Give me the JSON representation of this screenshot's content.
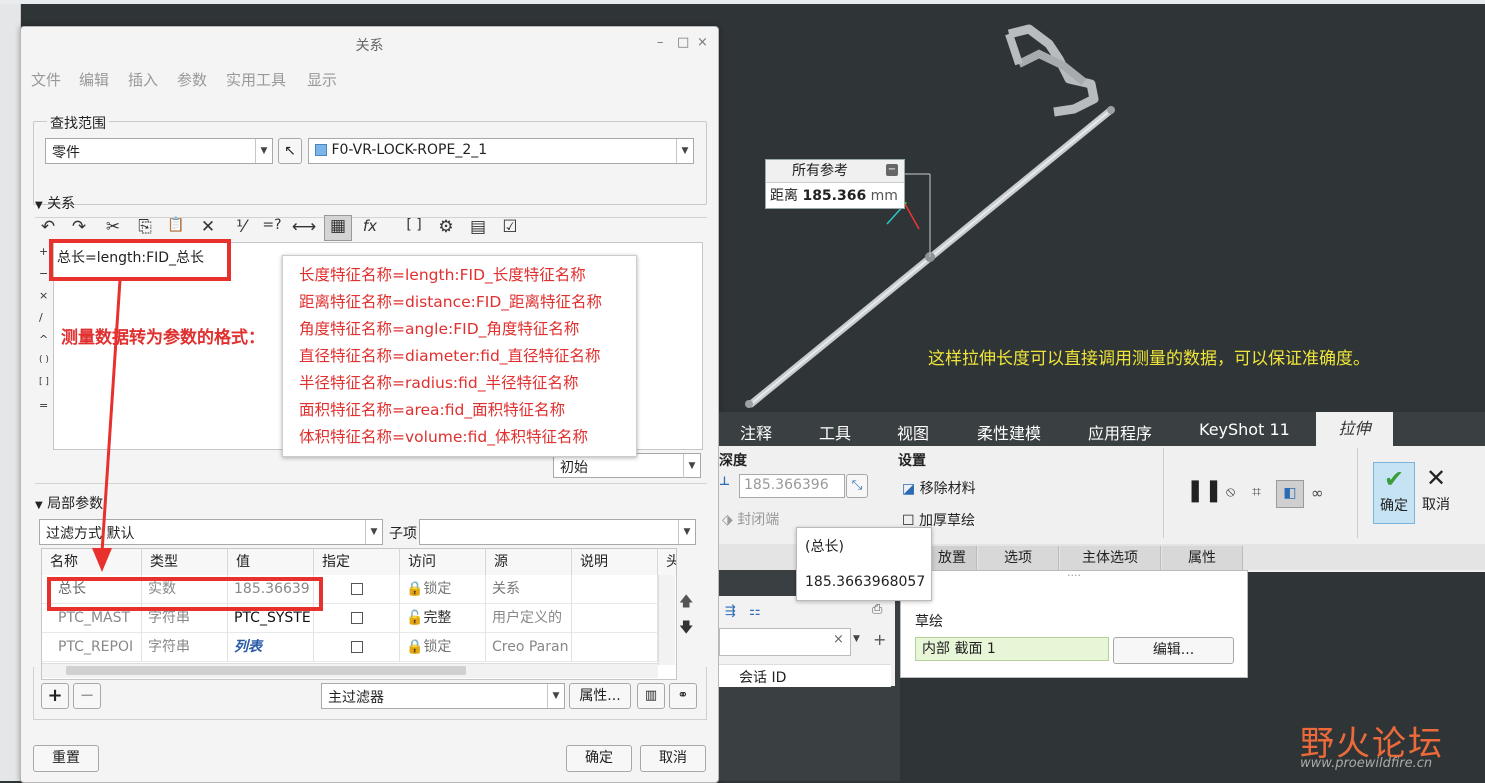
{
  "dialog": {
    "title": "关系",
    "window_controls": [
      "–",
      "□",
      "×"
    ],
    "menu": [
      "文件",
      "编辑",
      "插入",
      "参数",
      "实用工具",
      "显示"
    ],
    "scope": {
      "legend": "查找范围",
      "type_value": "零件",
      "model_value": "F0-VR-LOCK-ROPE_2_1"
    },
    "relations": {
      "header": "关系",
      "toolbar_icons": [
        "undo-icon",
        "redo-icon",
        "cut-icon",
        "copy-icon",
        "paste-icon",
        "delete-icon",
        "units-icon",
        "evaluate-icon",
        "insert-dimension-icon",
        "sort-icon",
        "function-icon",
        "brackets-icon",
        "verify-icon",
        "show-values-icon",
        "check-icon"
      ],
      "toolbar_glyphs": [
        "↶",
        "↷",
        "✂",
        "⎘",
        "📋",
        "✕",
        "⅟",
        "=?",
        "⟷",
        "▦",
        "fx",
        "[ ]",
        "⚙",
        "▤",
        "☑"
      ],
      "side_symbols": [
        "+",
        "−",
        "×",
        "/",
        "^",
        "( )",
        "[ ]",
        "="
      ],
      "editor_line": "总长=length:FID_总长",
      "initial_combo": "初始"
    },
    "local_params": {
      "header": "局部参数",
      "filter_label": "过滤方式",
      "filter_value": "默认",
      "subitem_label": "子项",
      "columns": [
        "名称",
        "类型",
        "值",
        "指定",
        "访问",
        "源",
        "说明",
        "头"
      ],
      "rows": [
        {
          "name": "总长",
          "type": "实数",
          "value": "185.36639",
          "access": "锁定",
          "source": "关系"
        },
        {
          "name": "PTC_MAST",
          "type": "字符串",
          "value": "PTC_SYSTE",
          "access": "完整",
          "source": "用户定义的"
        },
        {
          "name": "PTC_REPOI",
          "type": "字符串",
          "value": "列表",
          "access": "锁定",
          "source": "Creo Paran"
        }
      ],
      "main_filter": "主过滤器",
      "properties_button": "属性..."
    },
    "footer": {
      "reset": "重置",
      "ok": "确定",
      "cancel": "取消"
    }
  },
  "annotations": {
    "format_title": "测量数据转为参数的格式：",
    "format_lines": [
      "长度特征名称=length:FID_长度特征名称",
      "距离特征名称=distance:FID_距离特征名称",
      "角度特征名称=angle:FID_角度特征名称",
      "直径特征名称=diameter:fid_直径特征名称",
      "半径特征名称=radius:fid_半径特征名称",
      "面积特征名称=area:fid_面积特征名称",
      "体积特征名称=volume:fid_体积特征名称"
    ],
    "viewport_note": "这样拉伸长度可以直接调用测量的数据，可以保证准确度。"
  },
  "measure": {
    "header": "所有参考",
    "label": "距离",
    "value": "185.366",
    "unit": "mm"
  },
  "ribbon": {
    "tabs": [
      "注释",
      "工具",
      "视图",
      "柔性建模",
      "应用程序",
      "KeyShot 11",
      "拉伸"
    ],
    "depth_label": "深度",
    "depth_value": "185.366396",
    "settings_label": "设置",
    "remove_material": "移除材料",
    "close_ends": "封闭端",
    "thicken_sketch": "加厚草绘",
    "ok": "确定",
    "cancel": "取消",
    "subtabs": [
      "放置",
      "选项",
      "主体选项",
      "属性"
    ],
    "sketch_label": "草绘",
    "sketch_value": "内部 截面 1",
    "edit_button": "编辑...",
    "session_id": "会话 ID"
  },
  "tooltip": {
    "name": "(总长)",
    "value": "185.3663968057"
  },
  "watermark": {
    "name": "野火论坛",
    "url": "www.proewildfire.cn"
  },
  "colors": {
    "accent_red": "#e8302d",
    "note_yellow": "#f0e63a",
    "viewport_bg": "#2f3436"
  }
}
